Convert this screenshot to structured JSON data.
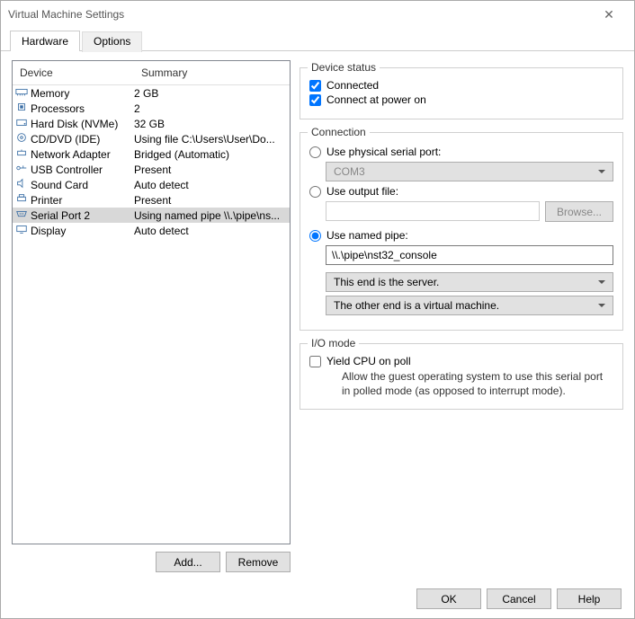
{
  "window": {
    "title": "Virtual Machine Settings"
  },
  "tabs": {
    "hardware": "Hardware",
    "options": "Options"
  },
  "device_table": {
    "header_device": "Device",
    "header_summary": "Summary",
    "rows": [
      {
        "name": "Memory",
        "summary": "2 GB"
      },
      {
        "name": "Processors",
        "summary": "2"
      },
      {
        "name": "Hard Disk (NVMe)",
        "summary": "32 GB"
      },
      {
        "name": "CD/DVD (IDE)",
        "summary": "Using file C:\\Users\\User\\Do..."
      },
      {
        "name": "Network Adapter",
        "summary": "Bridged (Automatic)"
      },
      {
        "name": "USB Controller",
        "summary": "Present"
      },
      {
        "name": "Sound Card",
        "summary": "Auto detect"
      },
      {
        "name": "Printer",
        "summary": "Present"
      },
      {
        "name": "Serial Port 2",
        "summary": "Using named pipe \\\\.\\pipe\\ns..."
      },
      {
        "name": "Display",
        "summary": "Auto detect"
      }
    ]
  },
  "buttons": {
    "add": "Add...",
    "remove": "Remove",
    "ok": "OK",
    "cancel": "Cancel",
    "help": "Help",
    "browse": "Browse..."
  },
  "device_status": {
    "title": "Device status",
    "connected": "Connected",
    "connect_power_on": "Connect at power on"
  },
  "connection": {
    "title": "Connection",
    "use_physical": "Use physical serial port:",
    "physical_value": "COM3",
    "use_output": "Use output file:",
    "output_value": "",
    "use_named_pipe": "Use named pipe:",
    "pipe_value": "\\\\.\\pipe\\nst32_console",
    "end_server": "This end is the server.",
    "other_end": "The other end is a virtual machine."
  },
  "io_mode": {
    "title": "I/O mode",
    "yield": "Yield CPU on poll",
    "desc": "Allow the guest operating system to use this serial port in polled mode (as opposed to interrupt mode)."
  }
}
